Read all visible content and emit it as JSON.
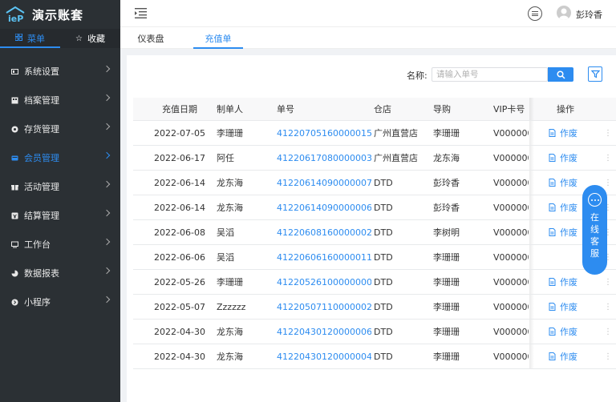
{
  "app": {
    "title": "演示账套"
  },
  "sidebar": {
    "tabs": [
      {
        "label": "菜单",
        "active": true
      },
      {
        "label": "收藏",
        "active": false
      }
    ],
    "items": [
      {
        "label": "系统设置",
        "icon": "settings-icon",
        "active": false
      },
      {
        "label": "档案管理",
        "icon": "archive-icon",
        "active": false
      },
      {
        "label": "存货管理",
        "icon": "inventory-icon",
        "active": false
      },
      {
        "label": "会员管理",
        "icon": "member-icon",
        "active": true
      },
      {
        "label": "活动管理",
        "icon": "gift-icon",
        "active": false
      },
      {
        "label": "结算管理",
        "icon": "settle-icon",
        "active": false
      },
      {
        "label": "工作台",
        "icon": "desk-icon",
        "active": false
      },
      {
        "label": "数据报表",
        "icon": "report-icon",
        "active": false
      },
      {
        "label": "小程序",
        "icon": "miniapp-icon",
        "active": false
      }
    ]
  },
  "header": {
    "user_name": "彭玲香"
  },
  "page_tabs": [
    {
      "label": "仪表盘",
      "active": false
    },
    {
      "label": "充值单",
      "active": true
    }
  ],
  "search": {
    "label": "名称:",
    "placeholder": "请输入单号"
  },
  "table": {
    "columns": [
      "充值日期",
      "制单人",
      "单号",
      "仓店",
      "导购",
      "VIP卡号",
      "操作"
    ],
    "op_label": "作废",
    "rows": [
      {
        "date": "2022-07-05",
        "maker": "李珊珊",
        "no": "412207051600000156",
        "store": "广州直营店",
        "guide": "李珊珊",
        "vip": "V000000",
        "op": true
      },
      {
        "date": "2022-06-17",
        "maker": "阿任",
        "no": "412206170800000033",
        "store": "广州直营店",
        "guide": "龙东海",
        "vip": "V000000",
        "op": true
      },
      {
        "date": "2022-06-14",
        "maker": "龙东海",
        "no": "412206140900000070",
        "store": "DTD",
        "guide": "彭玲香",
        "vip": "V000000",
        "op": true
      },
      {
        "date": "2022-06-14",
        "maker": "龙东海",
        "no": "412206140900000067",
        "store": "DTD",
        "guide": "彭玲香",
        "vip": "V000000",
        "op": true
      },
      {
        "date": "2022-06-08",
        "maker": "吴滔",
        "no": "412206081600000028",
        "store": "DTD",
        "guide": "李树明",
        "vip": "V000000",
        "op": true
      },
      {
        "date": "2022-06-06",
        "maker": "吴滔",
        "no": "412206061600000119",
        "store": "DTD",
        "guide": "李珊珊",
        "vip": "V000000",
        "op": false
      },
      {
        "date": "2022-05-26",
        "maker": "李珊珊",
        "no": "412205261000000005",
        "store": "DTD",
        "guide": "李珊珊",
        "vip": "V000000",
        "op": true
      },
      {
        "date": "2022-05-07",
        "maker": "Zzzzzz",
        "no": "412205071100000021",
        "store": "DTD",
        "guide": "李珊珊",
        "vip": "V000000",
        "op": true
      },
      {
        "date": "2022-04-30",
        "maker": "龙东海",
        "no": "412204301200000064",
        "store": "DTD",
        "guide": "李珊珊",
        "vip": "V000000",
        "op": true
      },
      {
        "date": "2022-04-30",
        "maker": "龙东海",
        "no": "412204301200000048",
        "store": "DTD",
        "guide": "李珊珊",
        "vip": "V000000",
        "op": true
      }
    ]
  },
  "service": {
    "label": "在线客服"
  },
  "colors": {
    "accent": "#2d8cf0",
    "sidebar_bg": "#2b3034"
  }
}
